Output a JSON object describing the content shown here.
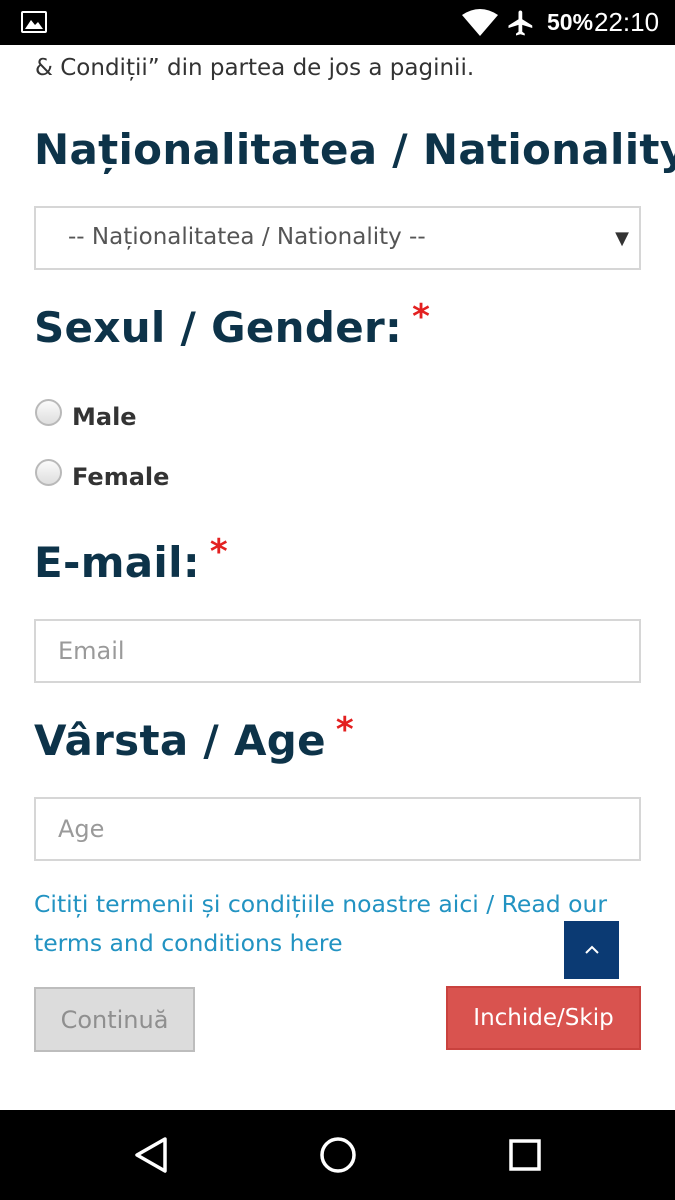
{
  "status_bar": {
    "battery": "50%",
    "time": "22:10",
    "icons": [
      "gallery-icon",
      "wifi-icon",
      "airplane-mode-icon"
    ]
  },
  "form": {
    "intro_text": "& Condiții” din partea de jos a paginii.",
    "nationality": {
      "label": "Naționalitatea / Nationality:",
      "required_mark": "*",
      "selected": "-- Naționalitatea / Nationality --"
    },
    "gender": {
      "label": "Sexul / Gender:",
      "required_mark": "*",
      "options": [
        "Male",
        "Female"
      ]
    },
    "email": {
      "label": "E-mail:",
      "required_mark": "*",
      "placeholder": "Email"
    },
    "age": {
      "label": "Vârsta / Age",
      "required_mark": "*",
      "placeholder": "Age"
    },
    "terms_link": "Citiți termenii și condițiile noastre aici / Read our terms and conditions here",
    "continue_label": "Continuă",
    "skip_label": "Inchide/Skip"
  },
  "colors": {
    "heading": "#0d3349",
    "required": "#e32020",
    "link": "#2293c2",
    "skip_button": "#d9534f",
    "scroll_top_button": "#0b3a73"
  }
}
